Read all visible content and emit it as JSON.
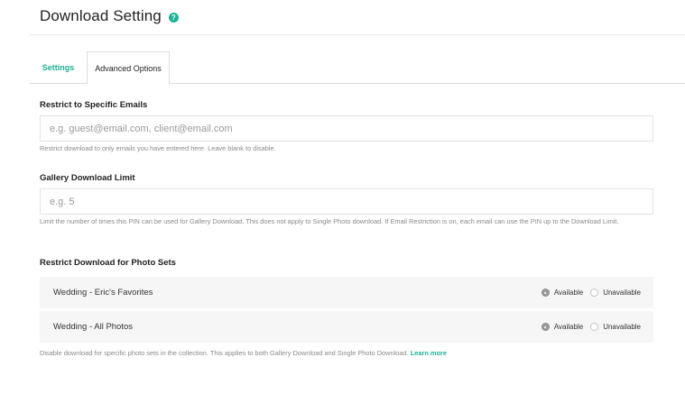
{
  "header": {
    "title": "Download Setting",
    "help_icon": "?"
  },
  "tabs": [
    {
      "label": "Settings",
      "active": false
    },
    {
      "label": "Advanced Options",
      "active": true
    }
  ],
  "restrict_emails": {
    "label": "Restrict to Specific Emails",
    "placeholder": "e.g. guest@email.com, client@email.com",
    "value": "",
    "help": "Restrict download to only emails you have entered here. Leave blank to disable."
  },
  "download_limit": {
    "label": "Gallery Download Limit",
    "placeholder": "e.g. 5",
    "value": "",
    "help": "Limit the number of times this PIN can be used for Gallery Download. This does not apply to Single Photo download. If Email Restriction is on, each email can use the PIN up to the Download Limit."
  },
  "photo_sets": {
    "label": "Restrict Download for Photo Sets",
    "option_available": "Available",
    "option_unavailable": "Unavailable",
    "rows": [
      {
        "name": "Wedding - Eric's Favorites",
        "selected": "Available"
      },
      {
        "name": "Wedding - All Photos",
        "selected": "Available"
      }
    ],
    "help": "Disable download for specific photo sets in the collection. This applies to both Gallery Download and Single Photo Download.",
    "learn_more": "Learn more"
  },
  "colors": {
    "accent": "#1fb197",
    "row_background": "#f6f6f6",
    "help_text": "#8a8a8a"
  }
}
